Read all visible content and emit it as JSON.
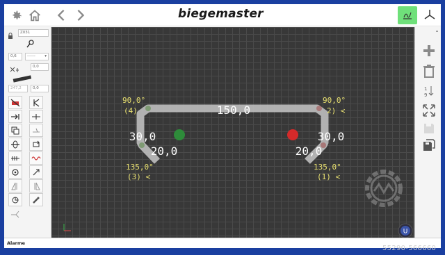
{
  "app": {
    "brand": "biegemaster"
  },
  "left_panel": {
    "program_field": "Z031",
    "diameter_value": "0,6",
    "material_value": "------",
    "offset_value": "0,0",
    "length_value": "247,2",
    "length_right_value": "0,0"
  },
  "drawing": {
    "segments": [
      {
        "label": "150,0"
      },
      {
        "label": "30,0"
      },
      {
        "label": "30,0"
      },
      {
        "label": "20,0"
      },
      {
        "label": "20,0"
      }
    ],
    "bends": [
      {
        "angle": "90,0°",
        "index": "(4)"
      },
      {
        "angle": "90,0°",
        "index": "2) <"
      },
      {
        "angle": "135,0°",
        "index": "(3) <"
      },
      {
        "angle": "135,0°",
        "index": "(1) <"
      }
    ],
    "markers": {
      "start_color": "#2e8b3a",
      "end_color": "#d42a2a"
    },
    "wire_color": "#bfbfbf",
    "label_color": "#e8e070",
    "badge": "U"
  },
  "status": {
    "alarm_label": "Alarme"
  },
  "footer": {
    "serial": "55290-566660"
  }
}
